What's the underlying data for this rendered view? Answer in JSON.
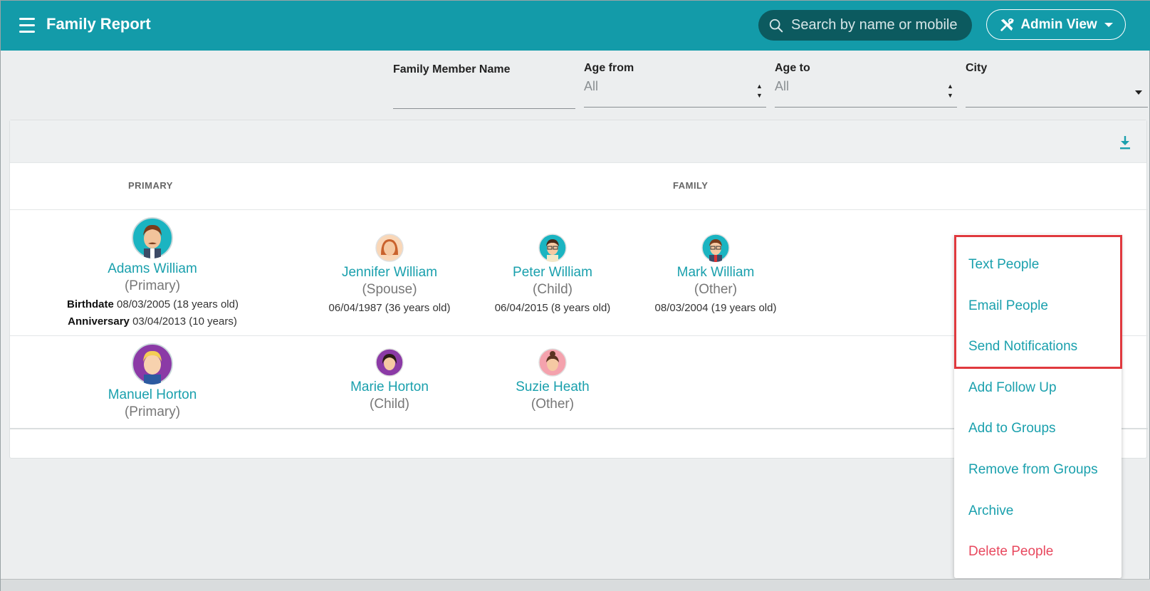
{
  "header": {
    "title": "Family Report",
    "search_placeholder": "Search by name or mobile",
    "admin_view_label": "Admin View"
  },
  "filters": {
    "family_member_name": {
      "label": "Family Member Name",
      "value": ""
    },
    "age_from": {
      "label": "Age from",
      "value": "All"
    },
    "age_to": {
      "label": "Age to",
      "value": "All"
    },
    "city": {
      "label": "City",
      "value": ""
    }
  },
  "table": {
    "col_primary": "PRIMARY",
    "col_family": "FAMILY"
  },
  "rows": [
    {
      "primary": {
        "name": "Adams William",
        "role": "(Primary)",
        "birthdate_label": "Birthdate",
        "birthdate": "08/03/2005 (18 years old)",
        "anniversary_label": "Anniversary",
        "anniversary": "03/04/2013 (10 years)"
      },
      "family": [
        {
          "name": "Jennifer William",
          "role": "(Spouse)",
          "meta": "06/04/1987 (36 years old)"
        },
        {
          "name": "Peter William",
          "role": "(Child)",
          "meta": "06/04/2015 (8 years old)"
        },
        {
          "name": "Mark William",
          "role": "(Other)",
          "meta": "08/03/2004 (19 years old)"
        }
      ]
    },
    {
      "primary": {
        "name": "Manuel Horton",
        "role": "(Primary)"
      },
      "family": [
        {
          "name": "Marie Horton",
          "role": "(Child)"
        },
        {
          "name": "Suzie Heath",
          "role": "(Other)"
        }
      ]
    }
  ],
  "action_menu": {
    "items": [
      "Text People",
      "Email People",
      "Send Notifications",
      "Add Follow Up",
      "Add to Groups",
      "Remove from Groups",
      "Archive",
      "Delete People"
    ]
  },
  "colors": {
    "header_bg": "#139ba9",
    "link": "#1aa0ad",
    "danger": "#e8485e",
    "highlight": "#e0393e"
  }
}
